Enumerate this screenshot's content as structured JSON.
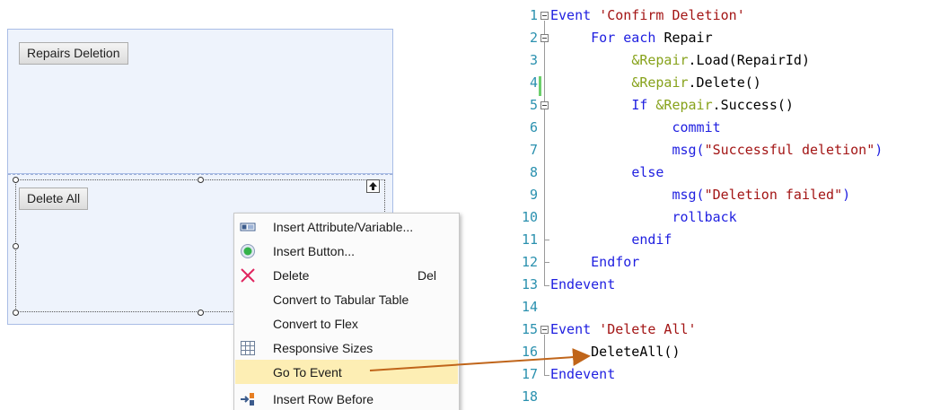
{
  "designer": {
    "top_button_label": "Repairs Deletion",
    "bottom_button_label": "Delete All"
  },
  "context_menu": {
    "items": [
      {
        "label": "Insert Attribute/Variable...",
        "shortcut": "",
        "icon": "attribute-variable-icon"
      },
      {
        "label": "Insert Button...",
        "shortcut": "",
        "icon": "button-icon"
      },
      {
        "label": "Delete",
        "shortcut": "Del",
        "icon": "delete-icon"
      },
      {
        "label": "Convert to Tabular Table",
        "shortcut": "",
        "icon": ""
      },
      {
        "label": "Convert to Flex",
        "shortcut": "",
        "icon": ""
      },
      {
        "label": "Responsive Sizes",
        "shortcut": "",
        "icon": "grid-icon"
      },
      {
        "label": "Go To Event",
        "shortcut": "",
        "icon": "",
        "highlighted": true
      },
      {
        "label": "Insert Row Before",
        "shortcut": "",
        "icon": "insert-row-icon"
      }
    ]
  },
  "editor": {
    "lines": [
      {
        "n": "1",
        "tokens": [
          [
            "kw",
            "Event "
          ],
          [
            "str",
            "'Confirm Deletion'"
          ]
        ]
      },
      {
        "n": "2",
        "tokens": [
          [
            "",
            "     "
          ],
          [
            "kw",
            "For each "
          ],
          [
            "",
            "Repair"
          ]
        ]
      },
      {
        "n": "3",
        "tokens": [
          [
            "",
            "          "
          ],
          [
            "var",
            "&Repair"
          ],
          [
            "",
            ".Load(RepairId)"
          ]
        ]
      },
      {
        "n": "4",
        "tokens": [
          [
            "",
            "          "
          ],
          [
            "var",
            "&Repair"
          ],
          [
            "",
            ".Delete()"
          ]
        ]
      },
      {
        "n": "5",
        "tokens": [
          [
            "",
            "          "
          ],
          [
            "kw",
            "If "
          ],
          [
            "var",
            "&Repair"
          ],
          [
            "",
            ".Success()"
          ]
        ]
      },
      {
        "n": "6",
        "tokens": [
          [
            "",
            "               "
          ],
          [
            "kw",
            "commit"
          ]
        ]
      },
      {
        "n": "7",
        "tokens": [
          [
            "",
            "               "
          ],
          [
            "kw",
            "msg("
          ],
          [
            "str",
            "\"Successful deletion\""
          ],
          [
            "kw",
            ")"
          ]
        ]
      },
      {
        "n": "8",
        "tokens": [
          [
            "",
            "          "
          ],
          [
            "kw",
            "else"
          ]
        ]
      },
      {
        "n": "9",
        "tokens": [
          [
            "",
            "               "
          ],
          [
            "kw",
            "msg("
          ],
          [
            "str",
            "\"Deletion failed\""
          ],
          [
            "kw",
            ")"
          ]
        ]
      },
      {
        "n": "10",
        "tokens": [
          [
            "",
            "               "
          ],
          [
            "kw",
            "rollback"
          ]
        ]
      },
      {
        "n": "11",
        "tokens": [
          [
            "",
            "          "
          ],
          [
            "kw",
            "endif"
          ]
        ]
      },
      {
        "n": "12",
        "tokens": [
          [
            "",
            "     "
          ],
          [
            "kw",
            "Endfor"
          ]
        ]
      },
      {
        "n": "13",
        "tokens": [
          [
            "kw",
            "Endevent"
          ]
        ]
      },
      {
        "n": "14",
        "tokens": []
      },
      {
        "n": "15",
        "tokens": [
          [
            "kw",
            "Event "
          ],
          [
            "str",
            "'Delete All'"
          ]
        ]
      },
      {
        "n": "16",
        "tokens": [
          [
            "",
            "     DeleteAll()"
          ]
        ]
      },
      {
        "n": "17",
        "tokens": [
          [
            "kw",
            "Endevent"
          ]
        ]
      },
      {
        "n": "18",
        "tokens": []
      }
    ]
  },
  "colors": {
    "keyword": "#1f1fe0",
    "string": "#a31515",
    "variable": "#87a21b",
    "line_number": "#2b91af",
    "menu_highlight": "#fdeeb4",
    "arrow": "#c0651a"
  }
}
